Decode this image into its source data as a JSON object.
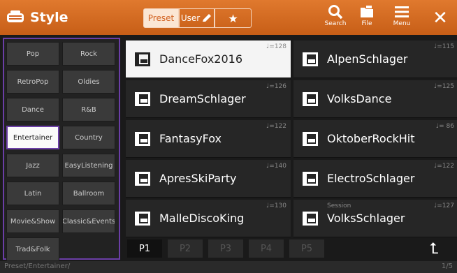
{
  "header": {
    "title": "Style",
    "preset_label": "Preset",
    "user_label": "User",
    "favorite_icon": "star-icon",
    "search_label": "Search",
    "file_label": "File",
    "menu_label": "Menu",
    "close_glyph": "✕",
    "accent_color": "#d2611f"
  },
  "categories": [
    "Pop",
    "Rock",
    "RetroPop",
    "Oldies",
    "Dance",
    "R&B",
    "Entertainer",
    "Country",
    "Jazz",
    "EasyListening",
    "Latin",
    "Ballroom",
    "Movie&Show",
    "Classic&Events",
    "Trad&Folk"
  ],
  "selected_category": "Entertainer",
  "styles": [
    {
      "name": "DanceFox2016",
      "tempo": "♩=128",
      "sub": ""
    },
    {
      "name": "AlpenSchlager",
      "tempo": "♩=115",
      "sub": ""
    },
    {
      "name": "DreamSchlager",
      "tempo": "♩=126",
      "sub": ""
    },
    {
      "name": "VolksDance",
      "tempo": "♩=125",
      "sub": ""
    },
    {
      "name": "FantasyFox",
      "tempo": "♩=122",
      "sub": ""
    },
    {
      "name": "OktoberRockHit",
      "tempo": "♩= 86",
      "sub": ""
    },
    {
      "name": "ApresSkiParty",
      "tempo": "♩=140",
      "sub": ""
    },
    {
      "name": "ElectroSchlager",
      "tempo": "♩=122",
      "sub": ""
    },
    {
      "name": "MalleDiscoKing",
      "tempo": "♩=130",
      "sub": ""
    },
    {
      "name": "VolksSchlager",
      "tempo": "♩=127",
      "sub": "Session"
    }
  ],
  "selected_style": "DanceFox2016",
  "pages": [
    "P1",
    "P2",
    "P3",
    "P4",
    "P5"
  ],
  "active_page": "P1",
  "status": {
    "path": "Preset/Entertainer/",
    "page_indicator": "1/5"
  }
}
